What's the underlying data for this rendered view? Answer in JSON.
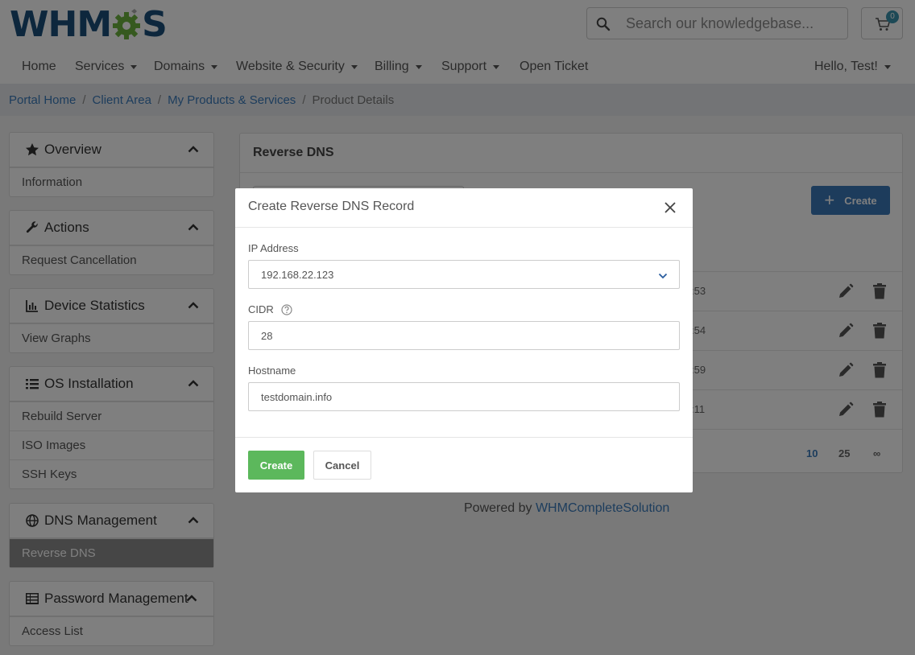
{
  "header": {
    "logo_text_left": "WHM",
    "logo_text_right": "S",
    "search_placeholder": "Search our knowledgebase...",
    "cart_count": "0"
  },
  "nav": {
    "home": "Home",
    "services": "Services",
    "domains": "Domains",
    "website_security": "Website & Security",
    "billing": "Billing",
    "support": "Support",
    "open_ticket": "Open Ticket",
    "user": "Hello, Test!"
  },
  "breadcrumb": {
    "portal_home": "Portal Home",
    "client_area": "Client Area",
    "products": "My Products & Services",
    "current": "Product Details",
    "separator": "/"
  },
  "sidebar": {
    "overview": {
      "title": "Overview",
      "items": [
        "Information"
      ]
    },
    "actions": {
      "title": "Actions",
      "items": [
        "Request Cancellation"
      ]
    },
    "device_statistics": {
      "title": "Device Statistics",
      "items": [
        "View Graphs"
      ]
    },
    "os_installation": {
      "title": "OS Installation",
      "items": [
        "Rebuild Server",
        "ISO Images",
        "SSH Keys"
      ]
    },
    "dns_management": {
      "title": "DNS Management",
      "items": [
        "Reverse DNS"
      ]
    },
    "password_management": {
      "title": "Password Management",
      "items": [
        "Access List"
      ]
    }
  },
  "main": {
    "title": "Reverse DNS",
    "create_label": "Create",
    "rows": [
      {
        "time_fragment": ":53"
      },
      {
        "time_fragment": ":54"
      },
      {
        "time_fragment": ":59"
      },
      {
        "time_fragment": ":11"
      }
    ],
    "pagination": [
      "10",
      "25",
      "∞"
    ]
  },
  "footer": {
    "powered_by": "Powered by",
    "link": "WHMCompleteSolution"
  },
  "modal": {
    "title": "Create Reverse DNS Record",
    "ip_label": "IP Address",
    "ip_value": "192.168.22.123",
    "cidr_label": "CIDR",
    "cidr_value": "28",
    "hostname_label": "Hostname",
    "hostname_value": "testdomain.info",
    "create_button": "Create",
    "cancel_button": "Cancel"
  },
  "colors": {
    "brand_blue": "#1a4f7a",
    "brand_green": "#6db33f",
    "primary_button": "#3a78b8",
    "success_button": "#5cb85c",
    "link": "#3a7aba"
  }
}
